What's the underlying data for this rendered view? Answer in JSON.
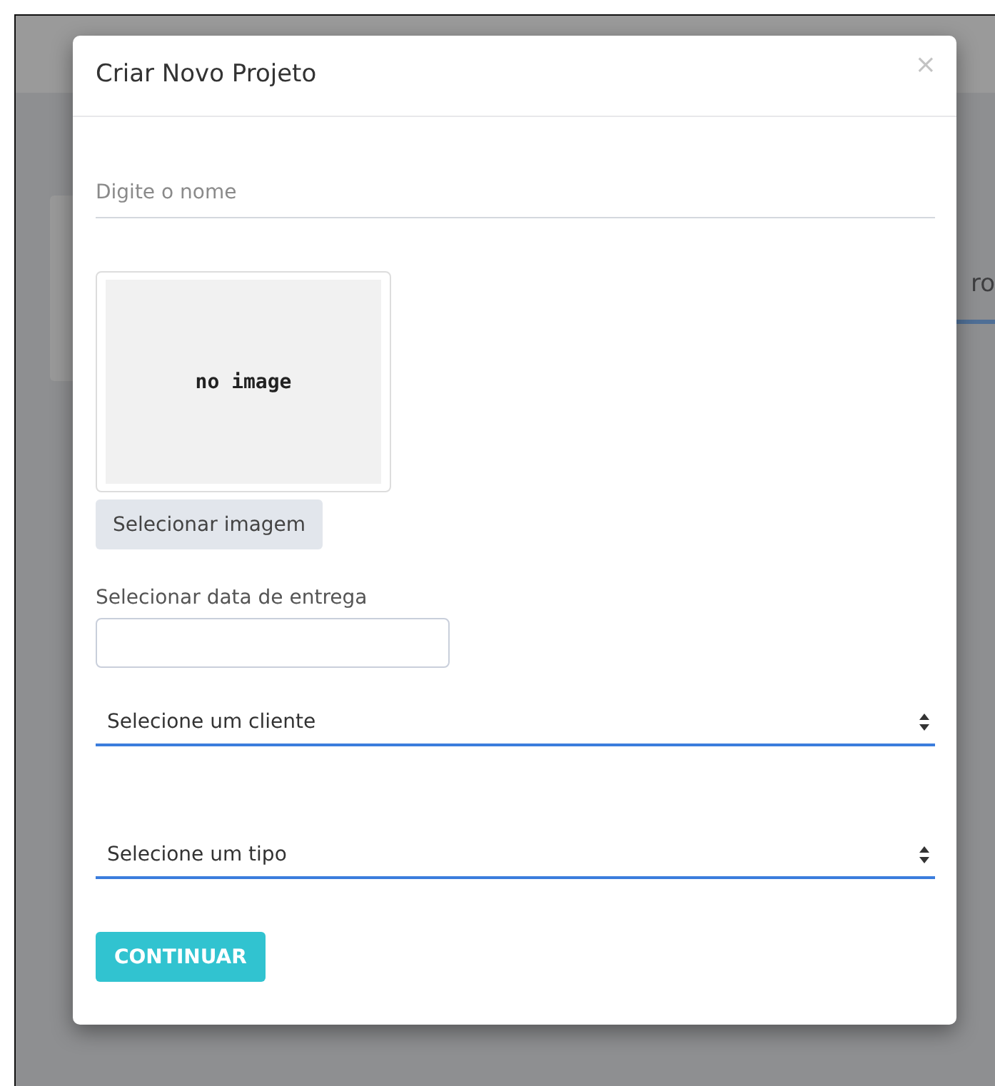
{
  "background": {
    "partial_text": "ro"
  },
  "modal": {
    "title": "Criar Novo Projeto",
    "close": "×",
    "name_field": {
      "placeholder": "Digite o nome"
    },
    "image": {
      "placeholder_text": "no image",
      "button": "Selecionar imagem"
    },
    "date_field": {
      "label": "Selecionar data de entrega"
    },
    "selects": [
      {
        "value": "Selecione um cliente"
      },
      {
        "value": "Selecione um tipo"
      }
    ],
    "submit": "CONTINUAR"
  }
}
